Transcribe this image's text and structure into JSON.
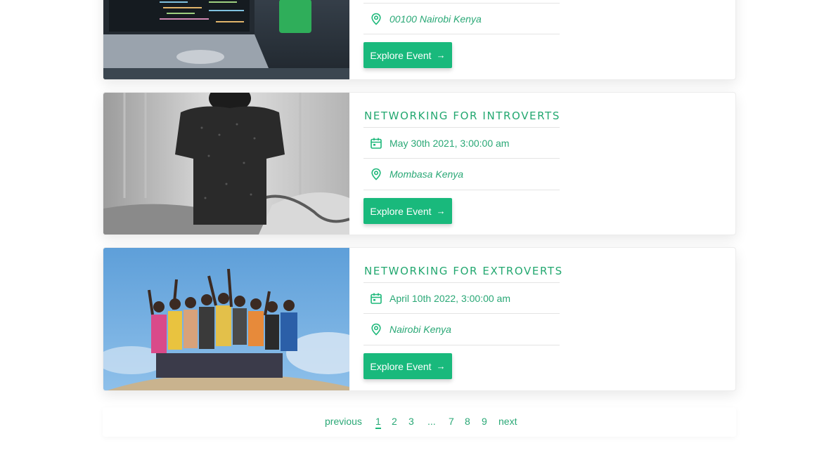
{
  "events": [
    {
      "title": "",
      "date": "",
      "location": "00100 Nairobi Kenya",
      "button_label": "Explore Event",
      "button_arrow": "→",
      "image": "laptop-desk-photo"
    },
    {
      "title": "NETWORKING FOR INTROVERTS",
      "date": "May 30th 2021, 3:00:00 am",
      "location": "Mombasa Kenya",
      "button_label": "Explore Event",
      "button_arrow": "→",
      "image": "person-sitting-on-bed-photo"
    },
    {
      "title": "NETWORKING FOR EXTROVERTS",
      "date": "April 10th 2022, 3:00:00 am",
      "location": "Nairobi Kenya",
      "button_label": "Explore Event",
      "button_arrow": "→",
      "image": "group-on-sand-dune-photo"
    }
  ],
  "icons": {
    "date": "calendar-icon",
    "location": "location-pin-icon"
  },
  "pagination": {
    "previous": "previous",
    "pages": [
      "1",
      "2",
      "3",
      "...",
      "7",
      "8",
      "9"
    ],
    "current": "1",
    "next": "next"
  },
  "colors": {
    "accent": "#19b97c",
    "text": "#2aa876",
    "border": "#e4e4e4"
  }
}
